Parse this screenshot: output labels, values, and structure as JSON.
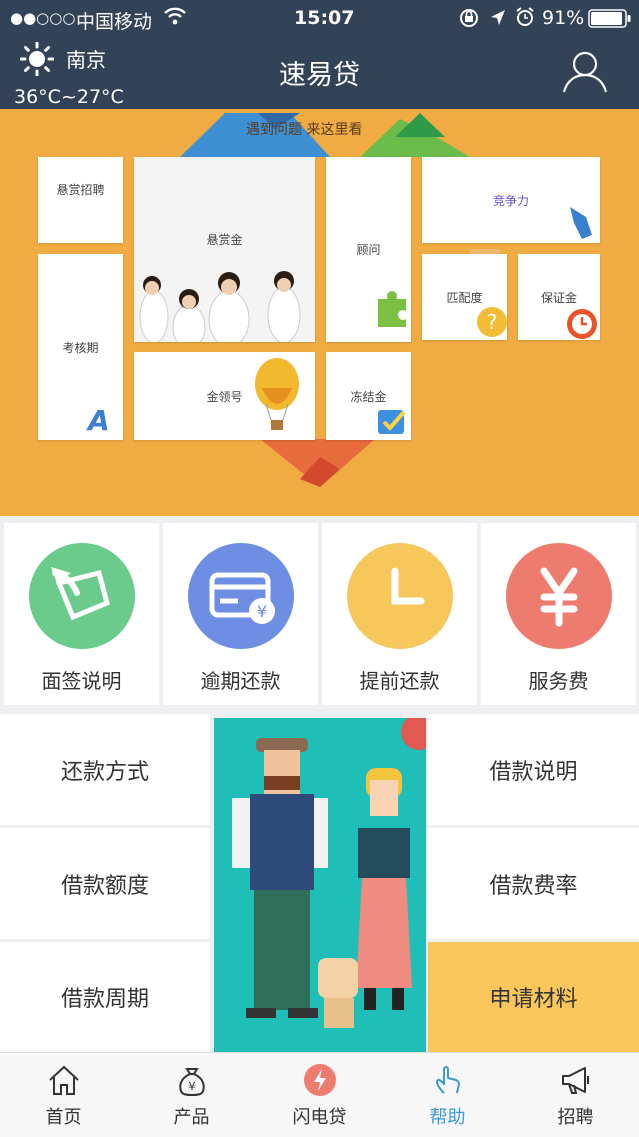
{
  "status": {
    "signal": "●●○○○",
    "carrier": "中国移动",
    "time": "15:07",
    "battery": "91%"
  },
  "header": {
    "city": "南京",
    "temp": "36°C~27°C",
    "title": "速易贷"
  },
  "banner": {
    "slogan": "遇到问题 来这里看",
    "tiles": [
      "悬赏招聘",
      "悬赏金",
      "顾问",
      "竞争力",
      "考核期",
      "匹配度",
      "保证金",
      "金领号",
      "冻结金"
    ]
  },
  "quick": [
    {
      "label": "面签说明",
      "icon": "signature-icon",
      "color": "#6acb8c"
    },
    {
      "label": "逾期还款",
      "icon": "card-yen-icon",
      "color": "#6d8ee2"
    },
    {
      "label": "提前还款",
      "icon": "clock-icon",
      "color": "#f7c75c"
    },
    {
      "label": "服务费",
      "icon": "yen-icon",
      "color": "#ed7c6e"
    }
  ],
  "faq": {
    "left": [
      "还款方式",
      "借款额度",
      "借款周期"
    ],
    "right": [
      "借款说明",
      "借款费率",
      "申请材料"
    ],
    "highlight_color": "#f8c65a"
  },
  "tabs": [
    {
      "label": "首页",
      "icon": "home-icon"
    },
    {
      "label": "产品",
      "icon": "money-bag-icon"
    },
    {
      "label": "闪电贷",
      "icon": "lightning-icon"
    },
    {
      "label": "帮助",
      "icon": "hand-pointer-icon",
      "active": true,
      "active_color": "#3a9ad9"
    },
    {
      "label": "招聘",
      "icon": "megaphone-icon"
    }
  ]
}
